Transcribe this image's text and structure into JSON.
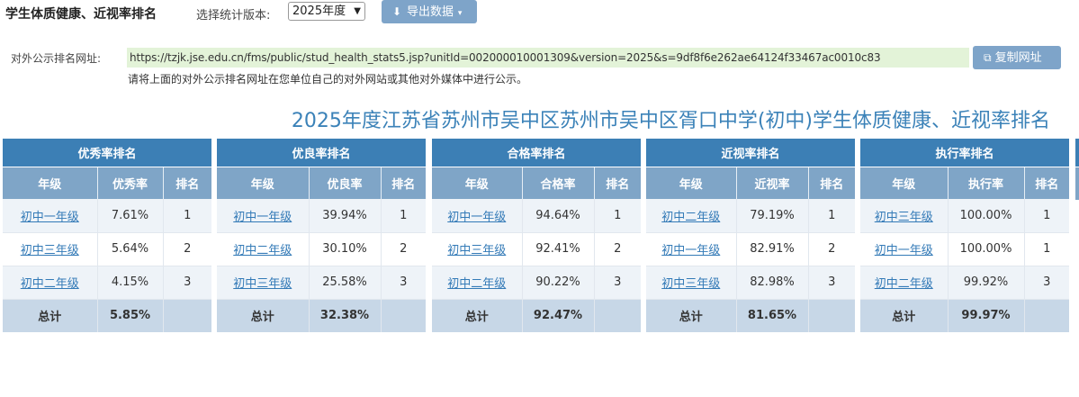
{
  "header": {
    "title": "学生体质健康、近视率排名",
    "version_label": "选择统计版本:",
    "version_selected": "2025年度",
    "export_label": "导出数据"
  },
  "url_section": {
    "label": "对外公示排名网址:",
    "url": "https://tzjk.jse.edu.cn/fms/public/stud_health_stats5.jsp?unitId=002000010001309&version=2025&s=9df8f6e262ae64124f33467ac0010c83",
    "copy_label": "复制网址",
    "hint": "请将上面的对外公示排名网址在您单位自己的对外网站或其他对外媒体中进行公示。"
  },
  "main_heading": "2025年度江苏省苏州市吴中区苏州市吴中区胥口中学(初中)学生体质健康、近视率排名",
  "panels": [
    {
      "title": "优秀率排名",
      "columns": [
        "年级",
        "优秀率",
        "排名"
      ],
      "rows": [
        {
          "grade": "初中一年级",
          "rate": "7.61%",
          "rank": "1"
        },
        {
          "grade": "初中三年级",
          "rate": "5.64%",
          "rank": "2"
        },
        {
          "grade": "初中二年级",
          "rate": "4.15%",
          "rank": "3"
        }
      ],
      "total_label": "总计",
      "total_rate": "5.85%"
    },
    {
      "title": "优良率排名",
      "columns": [
        "年级",
        "优良率",
        "排名"
      ],
      "rows": [
        {
          "grade": "初中一年级",
          "rate": "39.94%",
          "rank": "1"
        },
        {
          "grade": "初中二年级",
          "rate": "30.10%",
          "rank": "2"
        },
        {
          "grade": "初中三年级",
          "rate": "25.58%",
          "rank": "3"
        }
      ],
      "total_label": "总计",
      "total_rate": "32.38%"
    },
    {
      "title": "合格率排名",
      "columns": [
        "年级",
        "合格率",
        "排名"
      ],
      "rows": [
        {
          "grade": "初中一年级",
          "rate": "94.64%",
          "rank": "1"
        },
        {
          "grade": "初中三年级",
          "rate": "92.41%",
          "rank": "2"
        },
        {
          "grade": "初中二年级",
          "rate": "90.22%",
          "rank": "3"
        }
      ],
      "total_label": "总计",
      "total_rate": "92.47%"
    },
    {
      "title": "近视率排名",
      "columns": [
        "年级",
        "近视率",
        "排名"
      ],
      "rows": [
        {
          "grade": "初中二年级",
          "rate": "79.19%",
          "rank": "1"
        },
        {
          "grade": "初中一年级",
          "rate": "82.91%",
          "rank": "2"
        },
        {
          "grade": "初中三年级",
          "rate": "82.98%",
          "rank": "3"
        }
      ],
      "total_label": "总计",
      "total_rate": "81.65%"
    },
    {
      "title": "执行率排名",
      "columns": [
        "年级",
        "执行率",
        "排名"
      ],
      "rows": [
        {
          "grade": "初中三年级",
          "rate": "100.00%",
          "rank": "1"
        },
        {
          "grade": "初中一年级",
          "rate": "100.00%",
          "rank": "1"
        },
        {
          "grade": "初中二年级",
          "rate": "99.92%",
          "rank": "3"
        }
      ],
      "total_label": "总计",
      "total_rate": "99.97%"
    }
  ],
  "colors": {
    "header_blue": "#3c7fb5",
    "column_blue": "#7fa5c7",
    "total_row": "#c7d7e7",
    "heading_text": "#3b82b8",
    "url_bg": "#e3f3d8",
    "button": "#7ea4c9"
  }
}
